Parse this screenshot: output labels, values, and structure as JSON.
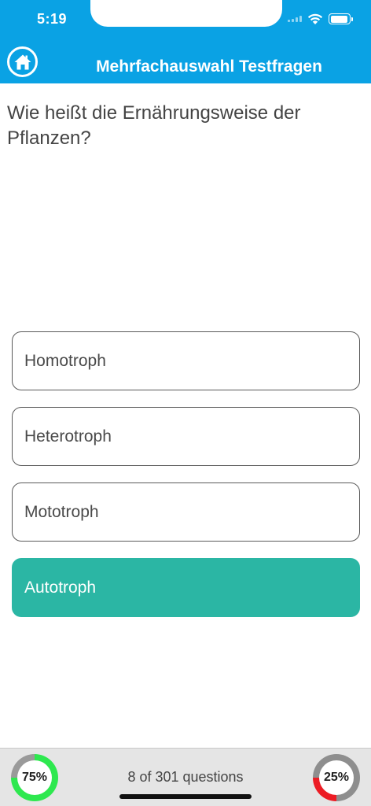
{
  "status_bar": {
    "time": "5:19"
  },
  "header": {
    "title": "Mehrfachauswahl Testfragen",
    "home_icon": "home-icon",
    "color": "#0aa2e4"
  },
  "question": {
    "text": "Wie heißt die Ernährungsweise der Pflanzen?"
  },
  "options": [
    {
      "label": "Homotroph",
      "selected": false
    },
    {
      "label": "Heterotroph",
      "selected": false
    },
    {
      "label": "Mototroph",
      "selected": false
    },
    {
      "label": "Autotroph",
      "selected": true
    }
  ],
  "footer": {
    "correct_percent": 75,
    "correct_label": "75%",
    "progress_text": "8 of 301 questions",
    "wrong_percent": 25,
    "wrong_label": "25%"
  },
  "colors": {
    "selected_option": "#2bb6a4",
    "correct_ring": "#2ee84f",
    "wrong_ring": "#ec1c24"
  }
}
